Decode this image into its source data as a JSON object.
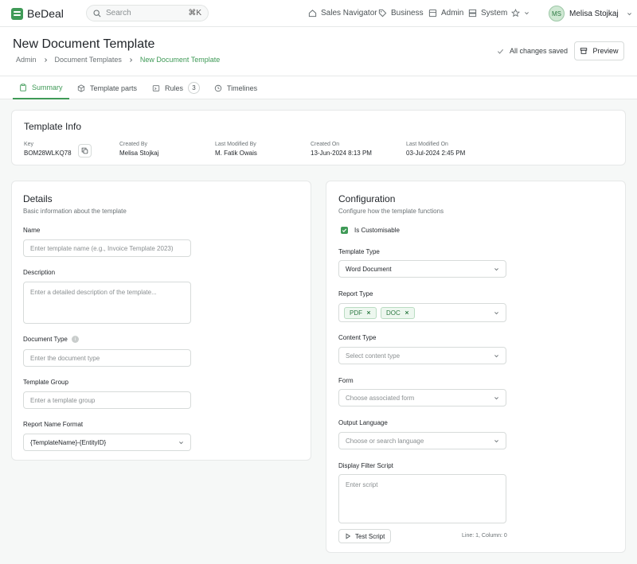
{
  "app": {
    "name": "BeDeal"
  },
  "search": {
    "placeholder": "Search",
    "shortcut": "⌘K"
  },
  "nav": {
    "items": [
      {
        "label": "Sales Navigator",
        "icon": "home-icon"
      },
      {
        "label": "Business",
        "icon": "tag-icon"
      },
      {
        "label": "Admin",
        "icon": "admin-icon"
      },
      {
        "label": "System",
        "icon": "server-icon"
      }
    ],
    "favorites_icon": "star-icon"
  },
  "user": {
    "initials": "MS",
    "name": "Melisa Stojkaj"
  },
  "header": {
    "title": "New Document Template",
    "breadcrumb": [
      "Admin",
      "Document Templates",
      "New Document Template"
    ],
    "saved_status": "All changes saved",
    "preview_label": "Preview"
  },
  "tabs": [
    {
      "label": "Summary",
      "active": true
    },
    {
      "label": "Template parts"
    },
    {
      "label": "Rules",
      "count": "3"
    },
    {
      "label": "Timelines"
    }
  ],
  "template_info": {
    "title": "Template Info",
    "fields": [
      {
        "label": "Key",
        "value": "BOM28WLKQ78"
      },
      {
        "label": "Created By",
        "value": "Melisa Stojkaj"
      },
      {
        "label": "Last Modified By",
        "value": "M. Fatik Owais"
      },
      {
        "label": "Created On",
        "value": "13-Jun-2024 8:13 PM"
      },
      {
        "label": "Last Modified On",
        "value": "03-Jul-2024 2:45 PM"
      }
    ]
  },
  "details": {
    "title": "Details",
    "subtitle": "Basic information about the template",
    "name": {
      "label": "Name",
      "placeholder": "Enter template name (e.g., Invoice Template 2023)",
      "value": ""
    },
    "description": {
      "label": "Description",
      "placeholder": "Enter a detailed description of the template...",
      "value": ""
    },
    "document_type": {
      "label": "Document Type",
      "placeholder": "Enter the document type",
      "value": ""
    },
    "template_group": {
      "label": "Template Group",
      "placeholder": "Enter a template group",
      "value": ""
    },
    "report_name_format": {
      "label": "Report Name Format",
      "value": "{TemplateName}-{EntityID}"
    }
  },
  "configuration": {
    "title": "Configuration",
    "subtitle": "Configure how the template functions",
    "is_customisable": {
      "label": "Is Customisable",
      "checked": true
    },
    "template_type": {
      "label": "Template Type",
      "value": "Word Document"
    },
    "report_type": {
      "label": "Report Type",
      "values": [
        "PDF",
        "DOC"
      ]
    },
    "content_type": {
      "label": "Content Type",
      "placeholder": "Select content type"
    },
    "form": {
      "label": "Form",
      "placeholder": "Choose associated form"
    },
    "output_language": {
      "label": "Output Language",
      "placeholder": "Choose or search language"
    },
    "display_filter_script": {
      "label": "Display Filter Script",
      "placeholder": "Enter script",
      "value": ""
    },
    "test_script_label": "Test Script",
    "cursor_position": "Line: 1, Column: 0"
  },
  "colors": {
    "accent": "#3f9a57",
    "background": "#f6f8f7"
  }
}
